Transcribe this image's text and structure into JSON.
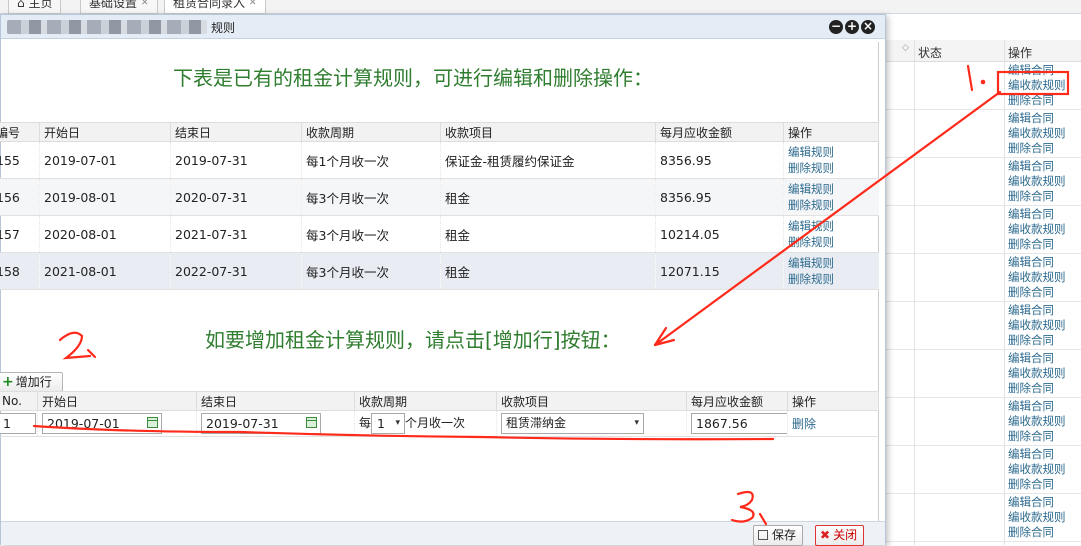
{
  "tabs": [
    {
      "label": "主页",
      "icon": "home-icon",
      "closable": false
    },
    {
      "label": "基础设置",
      "closable": true
    },
    {
      "label": "租赁合同录入",
      "closable": true
    }
  ],
  "background_grid": {
    "headers": {
      "status": "状态",
      "ops": "操作"
    },
    "row_ops": [
      "编辑合同",
      "编收款规则",
      "删除合同"
    ],
    "row_count": 10
  },
  "dialog": {
    "title": "规则",
    "title_blurred": true,
    "heading_existing": "下表是已有的租金计算规则，可进行编辑和删除操作：",
    "heading_add": "如要增加租金计算规则，请点击[增加行]按钮：",
    "rules_table": {
      "headers": [
        "编号",
        "开始日",
        "结束日",
        "收款周期",
        "收款项目",
        "每月应收金额",
        "操作"
      ],
      "rows": [
        {
          "no": "155",
          "start": "2019-07-01",
          "end": "2019-07-31",
          "cycle": "每1个月收一次",
          "item": "保证金-租赁履约保证金",
          "amount": "8356.95"
        },
        {
          "no": "156",
          "start": "2019-08-01",
          "end": "2020-07-31",
          "cycle": "每3个月收一次",
          "item": "租金",
          "amount": "8356.95"
        },
        {
          "no": "157",
          "start": "2020-08-01",
          "end": "2021-07-31",
          "cycle": "每3个月收一次",
          "item": "租金",
          "amount": "10214.05"
        },
        {
          "no": "158",
          "start": "2021-08-01",
          "end": "2022-07-31",
          "cycle": "每3个月收一次",
          "item": "租金",
          "amount": "12071.15"
        }
      ],
      "edit_label": "编辑规则",
      "delete_label": "删除规则"
    },
    "add_row_button": "增加行",
    "new_table": {
      "headers": [
        "No.",
        "开始日",
        "结束日",
        "收款周期",
        "收款项目",
        "每月应收金额",
        "操作"
      ],
      "row": {
        "no": "1",
        "start": "2019-07-01",
        "end": "2019-07-31",
        "cycle_prefix": "每",
        "cycle_value": "1",
        "cycle_suffix": "个月收一次",
        "item": "租赁滞纳金",
        "amount": "1867.56",
        "delete_label": "删除"
      }
    },
    "save_button": "保存",
    "close_button": "关闭"
  },
  "annotations": {
    "mark_1": "1.",
    "mark_2": "2.",
    "mark_3": "3.",
    "color": "#ff2a1a"
  }
}
